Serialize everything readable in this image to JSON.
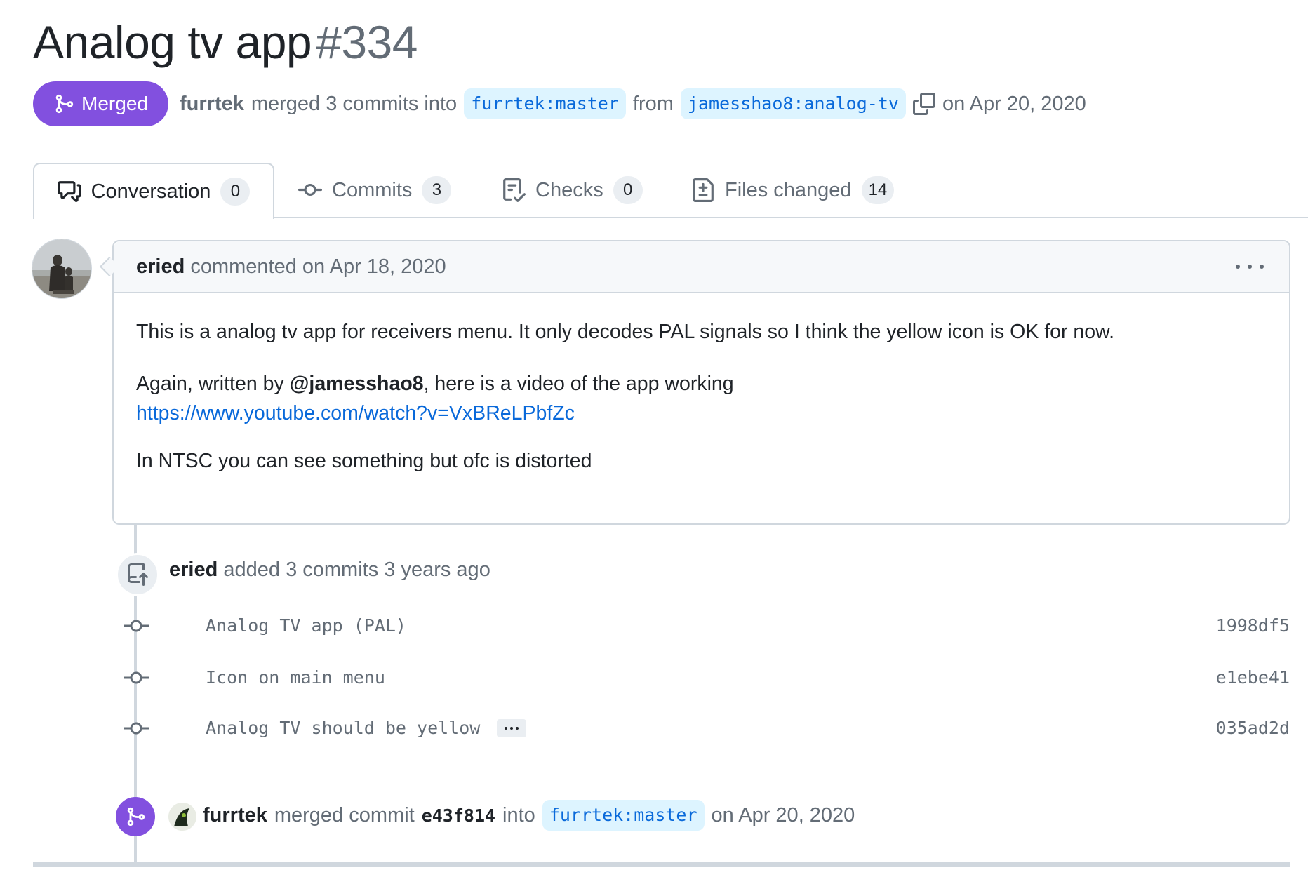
{
  "pr": {
    "title": "Analog tv app",
    "number": "#334",
    "state": "Merged",
    "author": "furrtek",
    "action": "merged 3 commits into",
    "base_branch": "furrtek:master",
    "from_word": "from",
    "head_branch": "jamesshao8:analog-tv",
    "date": "on Apr 20, 2020"
  },
  "tabs": [
    {
      "label": "Conversation",
      "count": "0",
      "icon": "comment-discussion-icon"
    },
    {
      "label": "Commits",
      "count": "3",
      "icon": "git-commit-icon"
    },
    {
      "label": "Checks",
      "count": "0",
      "icon": "checklist-icon"
    },
    {
      "label": "Files changed",
      "count": "14",
      "icon": "file-diff-icon"
    }
  ],
  "comment": {
    "author": "eried",
    "action": "commented on Apr 18, 2020",
    "paragraph1": "This is a analog tv app for receivers menu. It only decodes PAL signals so I think the yellow icon is OK for now.",
    "p2_prefix": "Again, written by ",
    "mention": "@jamesshao8",
    "p2_suffix": ", here is a video of the app working",
    "link": "https://www.youtube.com/watch?v=VxBReLPbfZc",
    "paragraph3": "In NTSC you can see something but ofc is distorted"
  },
  "commits_event": {
    "author": "eried",
    "action": "added 3 commits 3 years ago",
    "commits": [
      {
        "message": "Analog TV app (PAL)",
        "sha": "1998df5"
      },
      {
        "message": "Icon on main menu",
        "sha": "e1ebe41"
      },
      {
        "message": "Analog TV should be yellow",
        "sha": "035ad2d"
      }
    ]
  },
  "merge_event": {
    "author": "furrtek",
    "action": "merged commit",
    "sha": "e43f814",
    "into": "into",
    "branch": "furrtek:master",
    "date": "on Apr 20, 2020"
  },
  "colors": {
    "merged": "#8250df",
    "link": "#0969da",
    "branch_bg": "#ddf4ff"
  }
}
